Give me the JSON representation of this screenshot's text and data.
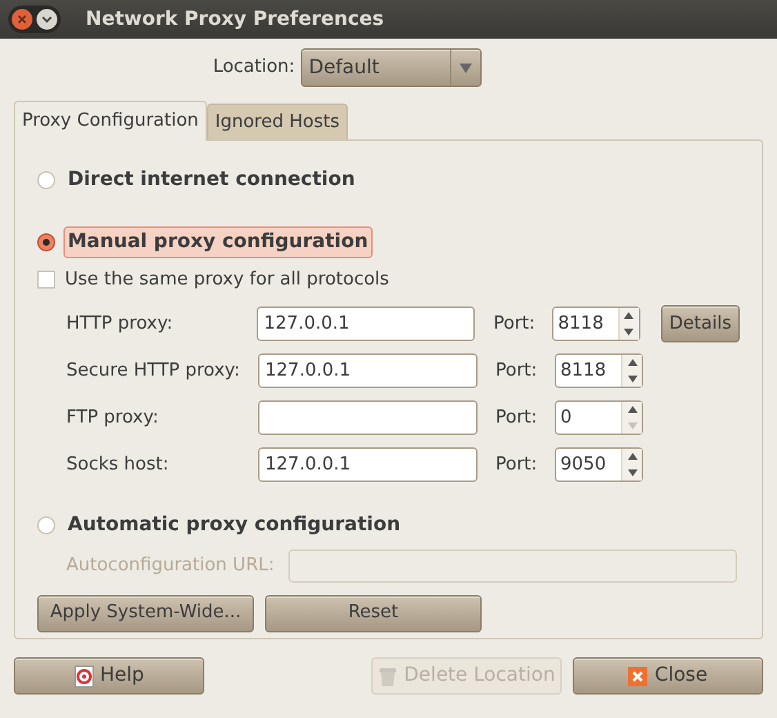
{
  "window": {
    "title": "Network Proxy Preferences"
  },
  "location": {
    "label": "Location:",
    "value": "Default"
  },
  "tabs": [
    {
      "label": "Proxy Configuration",
      "selected": true
    },
    {
      "label": "Ignored Hosts",
      "selected": false
    }
  ],
  "direct": {
    "label": "Direct internet connection",
    "selected": false
  },
  "manual": {
    "label": "Manual proxy configuration",
    "selected": true
  },
  "same_proxy": {
    "label": "Use the same proxy for all protocols",
    "checked": false
  },
  "proxies": [
    {
      "label": "HTTP proxy:",
      "value": "127.0.0.1",
      "port_label": "Port:",
      "port": "8118",
      "at_minimum": false,
      "details": "Details"
    },
    {
      "label": "Secure HTTP proxy:",
      "value": "127.0.0.1",
      "port_label": "Port:",
      "port": "8118",
      "at_minimum": false
    },
    {
      "label": "FTP proxy:",
      "port_label": "Port:",
      "port": "0",
      "at_minimum": true
    },
    {
      "label": "Socks host:",
      "value": "127.0.0.1",
      "port_label": "Port:",
      "port": "9050",
      "at_minimum": false
    }
  ],
  "automatic": {
    "label": "Automatic proxy configuration",
    "selected": false
  },
  "autoconfig": {
    "label": "Autoconfiguration URL:",
    "disabled": true
  },
  "panel_buttons": [
    "Apply System-Wide...",
    "Reset"
  ],
  "footer": [
    {
      "kind": "help",
      "label": "Help",
      "disabled": false
    },
    {
      "kind": "delete",
      "label": "Delete Location",
      "disabled": true
    },
    {
      "kind": "close",
      "label": "Close",
      "disabled": false
    }
  ]
}
